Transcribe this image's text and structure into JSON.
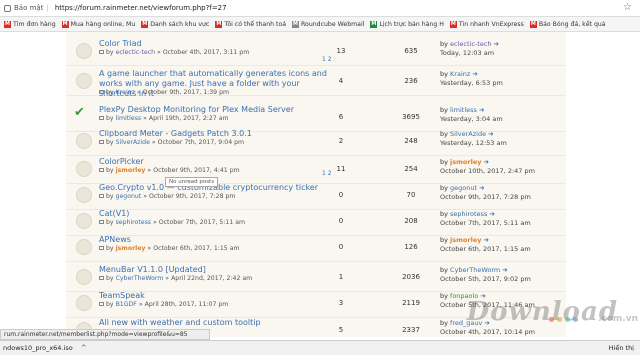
{
  "browser": {
    "security_label": "Bảo mật",
    "url": "https://forum.rainmeter.net/viewforum.php?f=27"
  },
  "bookmarks": [
    {
      "label": "Tìm đơn hàng",
      "icon": "gmail-icon",
      "color": "#d93025"
    },
    {
      "label": "Mua hàng online, Mu",
      "icon": "shop-icon",
      "color": "#d93025"
    },
    {
      "label": "Danh sách khu vực",
      "icon": "gmail-icon",
      "color": "#d93025"
    },
    {
      "label": "Tôi có thể thanh toá",
      "icon": "gmail-icon",
      "color": "#d93025"
    },
    {
      "label": "Roundcube Webmail",
      "icon": "page-icon",
      "color": "#888888"
    },
    {
      "label": "Lịch trực bản hàng H",
      "icon": "sheet-icon",
      "color": "#1e8e3e"
    },
    {
      "label": "Tin nhanh VnExpress",
      "icon": "news-icon",
      "color": "#d93025"
    },
    {
      "label": "Báo Bóng đá, kết quả",
      "icon": "ball-icon",
      "color": "#d93025"
    }
  ],
  "topics": [
    {
      "title": "Color Triad",
      "author": "eclectic-tech",
      "author_color": "purple",
      "date": "October 4th, 2017, 3:11 pm",
      "pages": "1 2",
      "replies": "13",
      "views": "635",
      "last_by": "eclectic-tech",
      "last_color": "purple",
      "last_time": "Today, 12:03 am",
      "icon": "topic"
    },
    {
      "title": "A game launcher that automatically generates icons and works with any game. Just have a folder with your shortcuts in it",
      "author": "Krainz",
      "author_color": "blue",
      "date": "October 9th, 2017, 1:39 pm",
      "pages": "",
      "replies": "4",
      "views": "236",
      "last_by": "Krainz",
      "last_color": "blue",
      "last_time": "Yesterday, 6:53 pm",
      "icon": "topic"
    },
    {
      "title": "PlexPy Desktop Monitoring for Plex Media Server",
      "author": "limitless",
      "author_color": "blue",
      "date": "April 19th, 2017, 2:27 am",
      "pages": "",
      "replies": "6",
      "views": "3695",
      "last_by": "limitless",
      "last_color": "blue",
      "last_time": "Yesterday, 3:04 am",
      "icon": "check"
    },
    {
      "title": "Clipboard Meter - Gadgets Patch 3.0.1",
      "author": "SilverAzide",
      "author_color": "blue",
      "date": "October 7th, 2017, 9:04 pm",
      "pages": "",
      "replies": "2",
      "views": "248",
      "last_by": "SilverAzide",
      "last_color": "blue",
      "last_time": "Yesterday, 12:53 am",
      "icon": "topic"
    },
    {
      "title": "ColorPicker",
      "author": "jsmorley",
      "author_color": "orange",
      "date": "October 9th, 2017, 4:41 pm",
      "pages": "1 2",
      "replies": "11",
      "views": "254",
      "last_by": "jsmorley",
      "last_color": "orange",
      "last_time": "October 10th, 2017, 2:47 pm",
      "icon": "topic"
    },
    {
      "title": "Geo.Crypto v1.0 — customizable cryptocurrency ticker",
      "author": "gegonut",
      "author_color": "blue",
      "date": "October 9th, 2017, 7:28 pm",
      "pages": "",
      "replies": "0",
      "views": "70",
      "last_by": "gegonut",
      "last_color": "blue",
      "last_time": "October 9th, 2017, 7:28 pm",
      "icon": "topic"
    },
    {
      "title": "Cat(V1)",
      "author": "sephirotess",
      "author_color": "blue",
      "date": "October 7th, 2017, 5:11 am",
      "pages": "",
      "replies": "0",
      "views": "208",
      "last_by": "sephirotess",
      "last_color": "blue",
      "last_time": "October 7th, 2017, 5:11 am",
      "icon": "topic"
    },
    {
      "title": "APNews",
      "author": "jsmorley",
      "author_color": "orange",
      "date": "October 6th, 2017, 1:15 am",
      "pages": "",
      "replies": "0",
      "views": "126",
      "last_by": "jsmorley",
      "last_color": "orange",
      "last_time": "October 6th, 2017, 1:15 am",
      "icon": "topic"
    },
    {
      "title": "MenuBar V1.1.0 [Updated]",
      "author": "CyberTheWorm",
      "author_color": "blue",
      "date": "April 22nd, 2017, 2:42 am",
      "pages": "",
      "replies": "1",
      "views": "2036",
      "last_by": "CyberTheWorm",
      "last_color": "blue",
      "last_time": "October 5th, 2017, 9:02 pm",
      "icon": "topic"
    },
    {
      "title": "TeamSpeak",
      "author": "B1GDF",
      "author_color": "blue",
      "date": "April 28th, 2017, 11:07 pm",
      "pages": "",
      "replies": "3",
      "views": "2119",
      "last_by": "fonpaolo",
      "last_color": "green",
      "last_time": "October 5th, 2017, 11:46 am",
      "icon": "topic"
    },
    {
      "title": "All new with weather and custom tooltip",
      "author": "",
      "author_color": "blue",
      "date": "",
      "pages": "",
      "replies": "5",
      "views": "2337",
      "last_by": "fred_gauv",
      "last_color": "blue",
      "last_time": "October 4th, 2017, 10:14 pm",
      "icon": "topic"
    }
  ],
  "tooltip": "No unread posts",
  "status_url": "rum.rainmeter.net/memberlist.php?mode=viewprofile&u=85",
  "download": {
    "file": "ndows10_pro_x64.iso",
    "action": "Hiển thị"
  },
  "watermark": {
    "text": "Download",
    "suffix": ".com.vn",
    "dots": [
      "#e74c3c",
      "#f39c12",
      "#2ecc71",
      "#3498db"
    ]
  }
}
